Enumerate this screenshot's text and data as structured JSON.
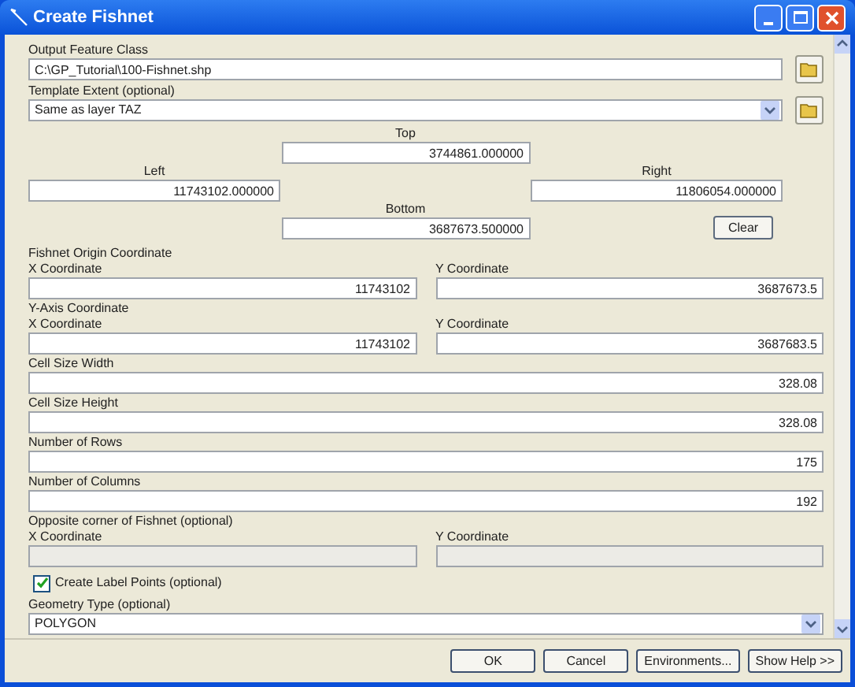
{
  "window": {
    "title": "Create Fishnet"
  },
  "output_feature_class": {
    "label": "Output Feature Class",
    "value": "C:\\GP_Tutorial\\100-Fishnet.shp"
  },
  "template_extent": {
    "label": "Template Extent (optional)",
    "value": "Same as layer TAZ"
  },
  "extent": {
    "top": {
      "label": "Top",
      "value": "3744861.000000"
    },
    "left": {
      "label": "Left",
      "value": "11743102.000000"
    },
    "right": {
      "label": "Right",
      "value": "11806054.000000"
    },
    "bottom": {
      "label": "Bottom",
      "value": "3687673.500000"
    },
    "clear_button": "Clear"
  },
  "rows": [
    {
      "kind": "pair",
      "title": "Fishnet Origin Coordinate",
      "disabled": false,
      "x": {
        "label": "X Coordinate",
        "value": "11743102"
      },
      "y": {
        "label": "Y Coordinate",
        "value": "3687673.5"
      }
    },
    {
      "kind": "pair",
      "title": "Y-Axis Coordinate",
      "disabled": false,
      "x": {
        "label": "X Coordinate",
        "value": "11743102"
      },
      "y": {
        "label": "Y Coordinate",
        "value": "3687683.5"
      }
    },
    {
      "kind": "single",
      "label": "Cell Size Width",
      "value": "328.08"
    },
    {
      "kind": "single",
      "label": "Cell Size Height",
      "value": "328.08"
    },
    {
      "kind": "single",
      "label": "Number of Rows",
      "value": "175"
    },
    {
      "kind": "single",
      "label": "Number of Columns",
      "value": "192"
    },
    {
      "kind": "pair",
      "title": "Opposite corner of Fishnet (optional)",
      "disabled": true,
      "x": {
        "label": "X Coordinate"
      },
      "y": {
        "label": "Y Coordinate"
      }
    }
  ],
  "label_points": {
    "label": "Create Label Points (optional)",
    "checked": true
  },
  "geometry_type": {
    "label": "Geometry Type (optional)",
    "value": "POLYGON"
  },
  "buttons": [
    "OK",
    "Cancel",
    "Environments...",
    "Show Help >>"
  ]
}
